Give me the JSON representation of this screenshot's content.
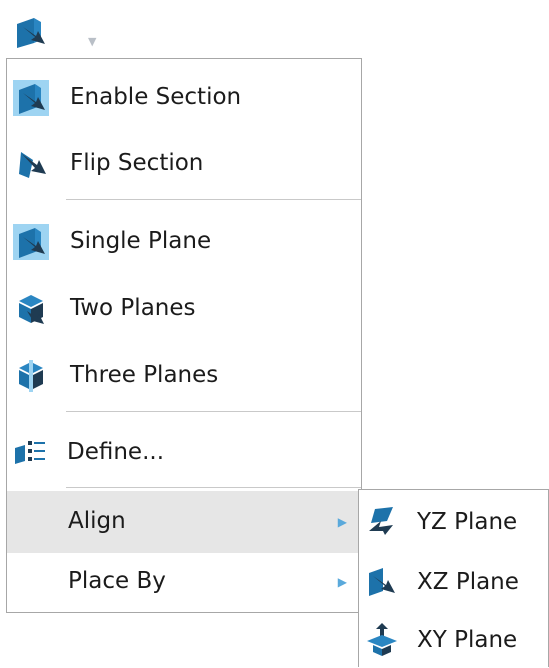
{
  "toolbar": {
    "section_icon": "section-plane-icon",
    "dropdown_icon": "chevron-down-icon"
  },
  "menu": {
    "enable_section": {
      "label": "Enable Section",
      "icon": "enable-section-icon",
      "checked": true
    },
    "flip_section": {
      "label": "Flip Section",
      "icon": "flip-section-icon"
    },
    "single_plane": {
      "label": "Single Plane",
      "icon": "single-plane-icon",
      "checked": true
    },
    "two_planes": {
      "label": "Two Planes",
      "icon": "two-planes-icon"
    },
    "three_planes": {
      "label": "Three Planes",
      "icon": "three-planes-icon"
    },
    "define": {
      "label": "Define...",
      "icon": "define-icon"
    },
    "align": {
      "label": "Align",
      "has_submenu": true,
      "highlighted": true
    },
    "place_by": {
      "label": "Place By",
      "has_submenu": true
    }
  },
  "submenu": {
    "yz_plane": {
      "label": "YZ Plane",
      "icon": "yz-plane-icon"
    },
    "xz_plane": {
      "label": "XZ Plane",
      "icon": "xz-plane-icon"
    },
    "xy_plane": {
      "label": "XY Plane",
      "icon": "xy-plane-icon"
    }
  },
  "colors": {
    "icon_blue": "#1d72aa",
    "icon_dark": "#1f3b52",
    "checked_bg": "#9ed4f2",
    "hover_bg": "#e6e6e6",
    "submenu_arrow": "#5aa9db"
  }
}
